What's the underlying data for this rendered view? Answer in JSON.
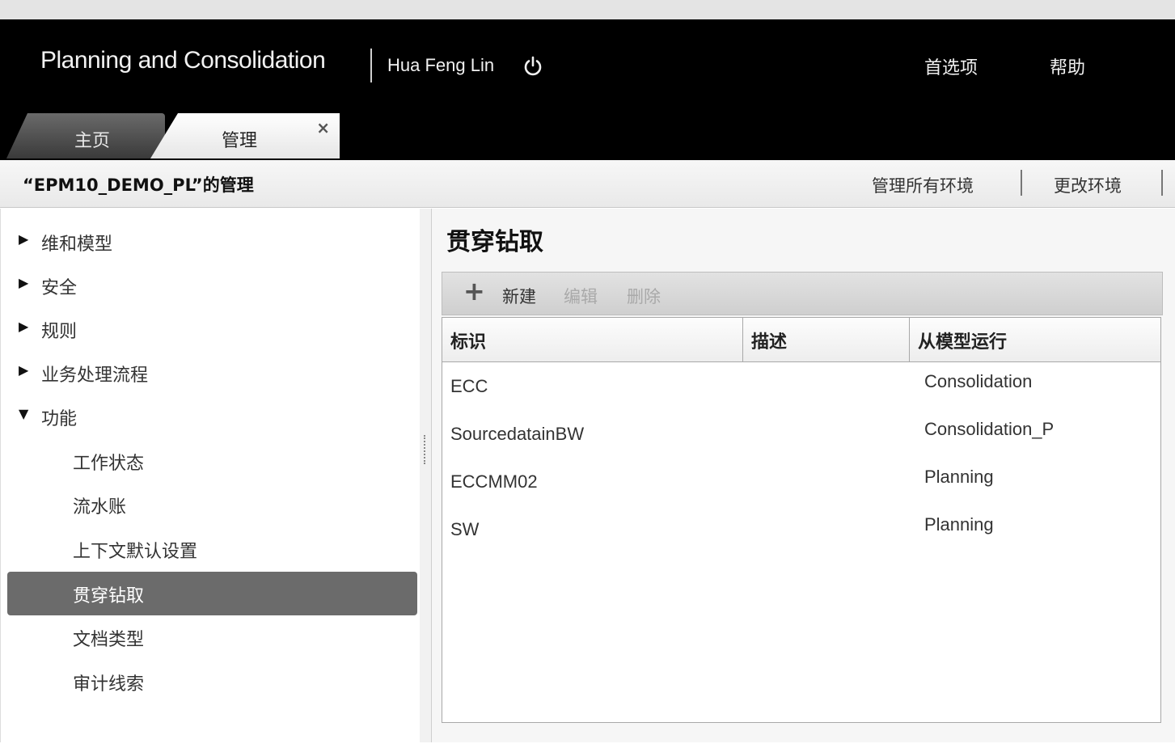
{
  "header": {
    "app_title": "Planning and Consolidation",
    "user_name": "Hua Feng Lin",
    "preferences_label": "首选项",
    "help_label": "帮助"
  },
  "tabs": [
    {
      "label": "主页"
    },
    {
      "label": "管理",
      "close": "×"
    }
  ],
  "subheader": {
    "title": "“EPM10_DEMO_PL”的管理",
    "manage_all_label": "管理所有环境",
    "change_env_label": "更改环境"
  },
  "sidebar": {
    "items": [
      {
        "label": "维和模型",
        "arrow": "▶"
      },
      {
        "label": "安全",
        "arrow": "▶"
      },
      {
        "label": "规则",
        "arrow": "▶"
      },
      {
        "label": "业务处理流程",
        "arrow": "▶"
      },
      {
        "label": "功能",
        "arrow": "▼"
      }
    ],
    "sub_items": [
      {
        "label": "工作状态"
      },
      {
        "label": "流水账"
      },
      {
        "label": "上下文默认设置"
      },
      {
        "label": "贯穿钻取"
      },
      {
        "label": "文档类型"
      },
      {
        "label": "审计线索"
      }
    ],
    "selected": "贯穿钻取"
  },
  "main": {
    "title": "贯穿钻取",
    "toolbar": {
      "new_label": "新建",
      "edit_label": "编辑",
      "delete_label": "删除"
    },
    "columns": [
      "标识",
      "描述",
      "从模型运行"
    ],
    "rows": [
      {
        "id": "ECC",
        "description": "",
        "model": "Consolidation"
      },
      {
        "id": "SourcedatainBW",
        "description": "",
        "model": "Consolidation_P"
      },
      {
        "id": "ECCMM02",
        "description": "",
        "model": "Planning"
      },
      {
        "id": "SW",
        "description": "",
        "model": "Planning"
      }
    ]
  }
}
